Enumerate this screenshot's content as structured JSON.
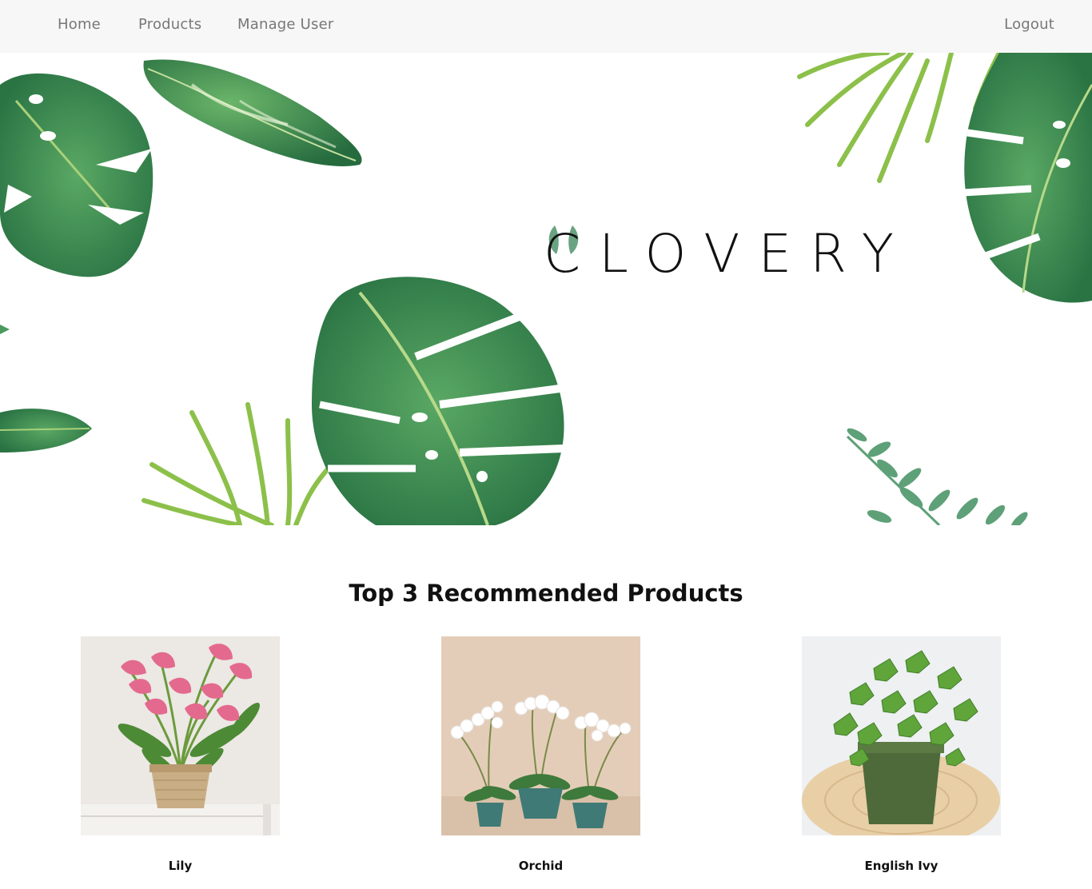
{
  "nav": {
    "home": "Home",
    "products": "Products",
    "manage_user": "Manage User",
    "logout": "Logout"
  },
  "hero": {
    "brand": "CLOVERY"
  },
  "section": {
    "title": "Top 3 Recommended Products"
  },
  "products": [
    {
      "name": "Lily"
    },
    {
      "name": "Orchid"
    },
    {
      "name": "English Ivy"
    }
  ],
  "colors": {
    "navbar_bg": "#f7f7f7",
    "nav_text": "#777777",
    "leaf_dark": "#2e7d4a",
    "leaf_mid": "#4a9a5c",
    "leaf_light": "#9cc85a"
  }
}
